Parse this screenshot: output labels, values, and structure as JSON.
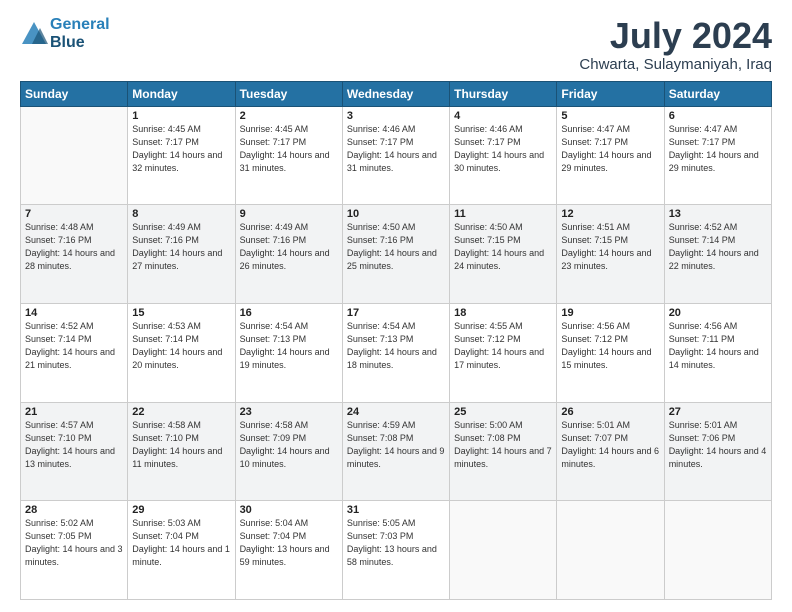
{
  "header": {
    "logo_line1": "General",
    "logo_line2": "Blue",
    "month_year": "July 2024",
    "location": "Chwarta, Sulaymaniyah, Iraq"
  },
  "weekdays": [
    "Sunday",
    "Monday",
    "Tuesday",
    "Wednesday",
    "Thursday",
    "Friday",
    "Saturday"
  ],
  "weeks": [
    [
      {
        "day": "",
        "sunrise": "",
        "sunset": "",
        "daylight": ""
      },
      {
        "day": "1",
        "sunrise": "4:45 AM",
        "sunset": "7:17 PM",
        "daylight": "14 hours and 32 minutes."
      },
      {
        "day": "2",
        "sunrise": "4:45 AM",
        "sunset": "7:17 PM",
        "daylight": "14 hours and 31 minutes."
      },
      {
        "day": "3",
        "sunrise": "4:46 AM",
        "sunset": "7:17 PM",
        "daylight": "14 hours and 31 minutes."
      },
      {
        "day": "4",
        "sunrise": "4:46 AM",
        "sunset": "7:17 PM",
        "daylight": "14 hours and 30 minutes."
      },
      {
        "day": "5",
        "sunrise": "4:47 AM",
        "sunset": "7:17 PM",
        "daylight": "14 hours and 29 minutes."
      },
      {
        "day": "6",
        "sunrise": "4:47 AM",
        "sunset": "7:17 PM",
        "daylight": "14 hours and 29 minutes."
      }
    ],
    [
      {
        "day": "7",
        "sunrise": "4:48 AM",
        "sunset": "7:16 PM",
        "daylight": "14 hours and 28 minutes."
      },
      {
        "day": "8",
        "sunrise": "4:49 AM",
        "sunset": "7:16 PM",
        "daylight": "14 hours and 27 minutes."
      },
      {
        "day": "9",
        "sunrise": "4:49 AM",
        "sunset": "7:16 PM",
        "daylight": "14 hours and 26 minutes."
      },
      {
        "day": "10",
        "sunrise": "4:50 AM",
        "sunset": "7:16 PM",
        "daylight": "14 hours and 25 minutes."
      },
      {
        "day": "11",
        "sunrise": "4:50 AM",
        "sunset": "7:15 PM",
        "daylight": "14 hours and 24 minutes."
      },
      {
        "day": "12",
        "sunrise": "4:51 AM",
        "sunset": "7:15 PM",
        "daylight": "14 hours and 23 minutes."
      },
      {
        "day": "13",
        "sunrise": "4:52 AM",
        "sunset": "7:14 PM",
        "daylight": "14 hours and 22 minutes."
      }
    ],
    [
      {
        "day": "14",
        "sunrise": "4:52 AM",
        "sunset": "7:14 PM",
        "daylight": "14 hours and 21 minutes."
      },
      {
        "day": "15",
        "sunrise": "4:53 AM",
        "sunset": "7:14 PM",
        "daylight": "14 hours and 20 minutes."
      },
      {
        "day": "16",
        "sunrise": "4:54 AM",
        "sunset": "7:13 PM",
        "daylight": "14 hours and 19 minutes."
      },
      {
        "day": "17",
        "sunrise": "4:54 AM",
        "sunset": "7:13 PM",
        "daylight": "14 hours and 18 minutes."
      },
      {
        "day": "18",
        "sunrise": "4:55 AM",
        "sunset": "7:12 PM",
        "daylight": "14 hours and 17 minutes."
      },
      {
        "day": "19",
        "sunrise": "4:56 AM",
        "sunset": "7:12 PM",
        "daylight": "14 hours and 15 minutes."
      },
      {
        "day": "20",
        "sunrise": "4:56 AM",
        "sunset": "7:11 PM",
        "daylight": "14 hours and 14 minutes."
      }
    ],
    [
      {
        "day": "21",
        "sunrise": "4:57 AM",
        "sunset": "7:10 PM",
        "daylight": "14 hours and 13 minutes."
      },
      {
        "day": "22",
        "sunrise": "4:58 AM",
        "sunset": "7:10 PM",
        "daylight": "14 hours and 11 minutes."
      },
      {
        "day": "23",
        "sunrise": "4:58 AM",
        "sunset": "7:09 PM",
        "daylight": "14 hours and 10 minutes."
      },
      {
        "day": "24",
        "sunrise": "4:59 AM",
        "sunset": "7:08 PM",
        "daylight": "14 hours and 9 minutes."
      },
      {
        "day": "25",
        "sunrise": "5:00 AM",
        "sunset": "7:08 PM",
        "daylight": "14 hours and 7 minutes."
      },
      {
        "day": "26",
        "sunrise": "5:01 AM",
        "sunset": "7:07 PM",
        "daylight": "14 hours and 6 minutes."
      },
      {
        "day": "27",
        "sunrise": "5:01 AM",
        "sunset": "7:06 PM",
        "daylight": "14 hours and 4 minutes."
      }
    ],
    [
      {
        "day": "28",
        "sunrise": "5:02 AM",
        "sunset": "7:05 PM",
        "daylight": "14 hours and 3 minutes."
      },
      {
        "day": "29",
        "sunrise": "5:03 AM",
        "sunset": "7:04 PM",
        "daylight": "14 hours and 1 minute."
      },
      {
        "day": "30",
        "sunrise": "5:04 AM",
        "sunset": "7:04 PM",
        "daylight": "13 hours and 59 minutes."
      },
      {
        "day": "31",
        "sunrise": "5:05 AM",
        "sunset": "7:03 PM",
        "daylight": "13 hours and 58 minutes."
      },
      {
        "day": "",
        "sunrise": "",
        "sunset": "",
        "daylight": ""
      },
      {
        "day": "",
        "sunrise": "",
        "sunset": "",
        "daylight": ""
      },
      {
        "day": "",
        "sunrise": "",
        "sunset": "",
        "daylight": ""
      }
    ]
  ]
}
